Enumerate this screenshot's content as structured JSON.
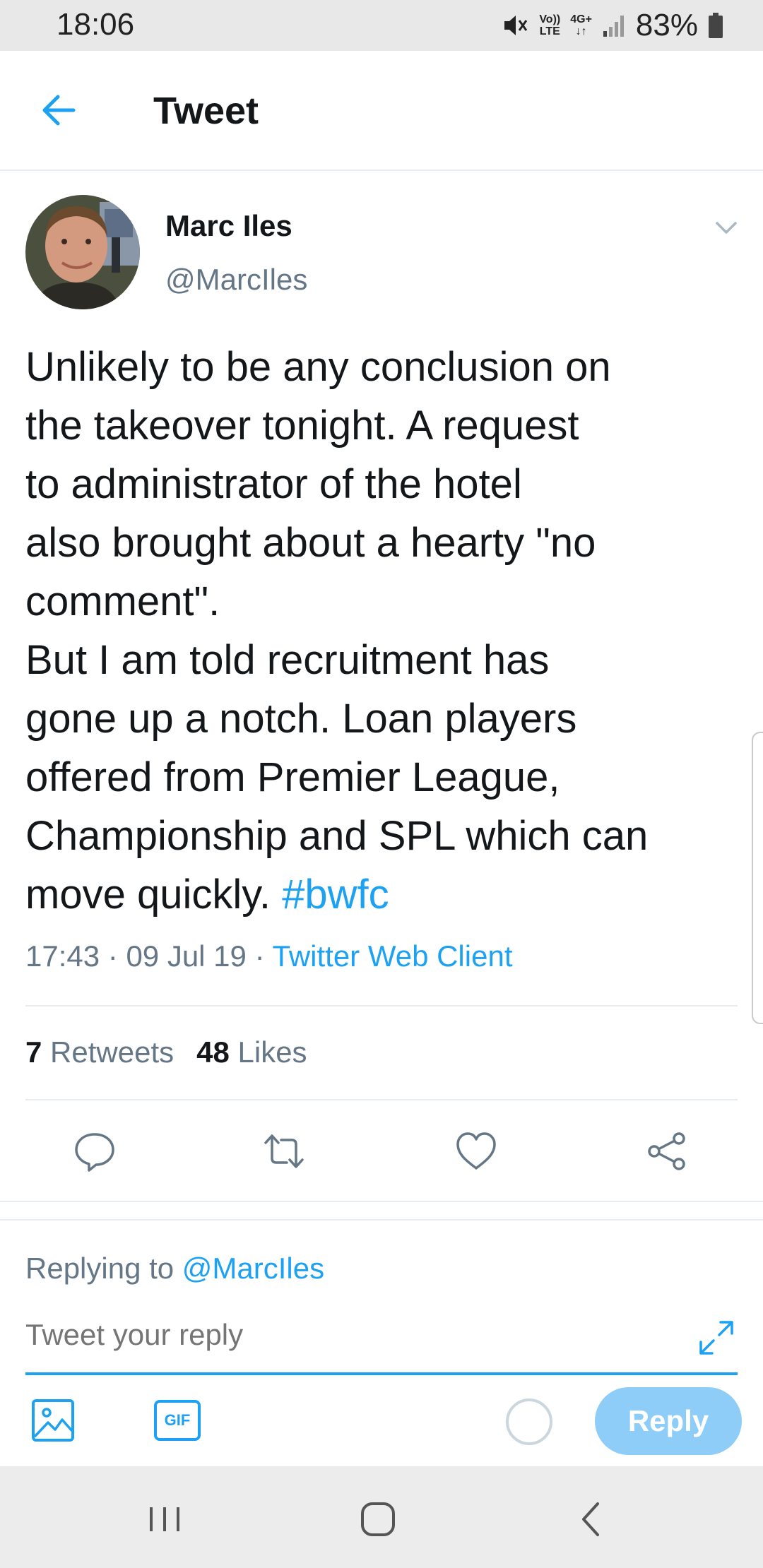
{
  "status_bar": {
    "time": "18:06",
    "battery": "83%",
    "network": "4G+",
    "volte_top": "Vo))",
    "volte_bottom": "LTE",
    "icons": [
      "mute-icon",
      "volte-icon",
      "4g-plus-icon",
      "signal-icon",
      "battery-icon"
    ]
  },
  "header": {
    "title": "Tweet",
    "back_icon": "arrow-left-icon"
  },
  "tweet": {
    "author_name": "Marc Iles",
    "author_handle": "@MarcIles",
    "text_lines": [
      "Unlikely to be any conclusion on",
      "the takeover tonight. A request",
      "to administrator of the hotel",
      "also brought about a hearty \"no",
      "comment\".",
      "But I am told recruitment has",
      "gone up a notch. Loan players",
      "offered from Premier League,",
      "Championship and SPL which can",
      "move quickly. "
    ],
    "hashtag": "#bwfc",
    "time": "17:43",
    "date": "09 Jul 19",
    "separator": " · ",
    "client": "Twitter Web Client",
    "retweets_count": "7",
    "retweets_label": "Retweets",
    "likes_count": "48",
    "likes_label": "Likes"
  },
  "actions": {
    "icons": [
      "reply-icon",
      "retweet-icon",
      "like-icon",
      "share-icon"
    ]
  },
  "reply": {
    "replying_label": "Replying to",
    "replying_handle": "@MarcIles",
    "placeholder": "Tweet your reply",
    "gif_label": "GIF",
    "button_label": "Reply"
  },
  "colors": {
    "accent": "#1da1f2",
    "reply_button_disabled": "#8ecdf8",
    "text_primary": "#14171a",
    "text_secondary": "#657786",
    "divider": "#e6ecf0"
  }
}
